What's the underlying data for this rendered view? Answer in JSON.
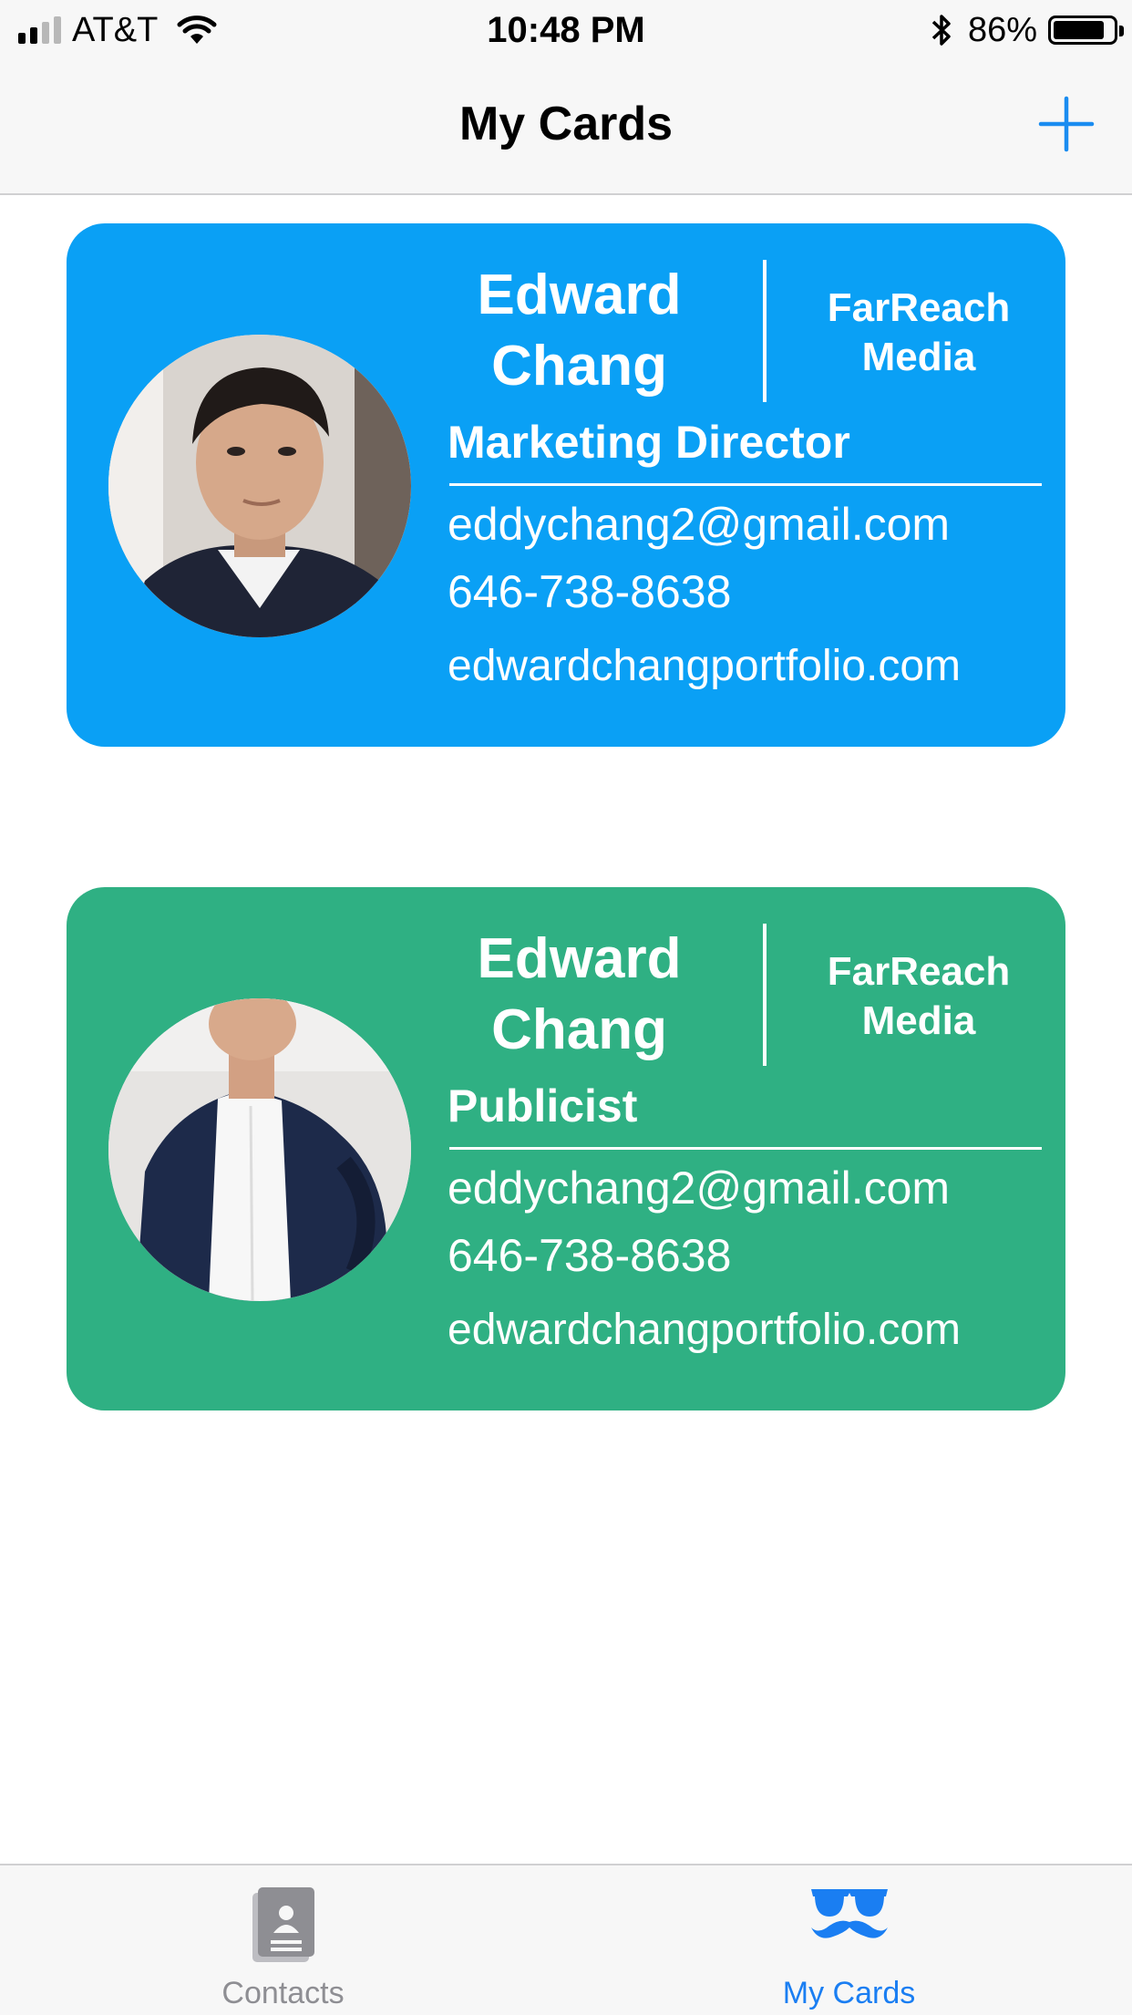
{
  "status_bar": {
    "carrier": "AT&T",
    "time": "10:48 PM",
    "battery_percent": "86%",
    "battery_level": 0.86,
    "signal_bars": 4,
    "signal_active": 2
  },
  "nav": {
    "title": "My Cards",
    "add_icon": "plus-icon",
    "accent_color": "#1a8cf0"
  },
  "cards": [
    {
      "background": "#0aa0f5",
      "first_name": "Edward",
      "last_name": "Chang",
      "company_line1": "FarReach",
      "company_line2": "Media",
      "job_title": "Marketing Director",
      "email": "eddychang2@gmail.com",
      "phone": "646-738-8638",
      "website": "edwardchangportfolio.com"
    },
    {
      "background": "#2fb083",
      "first_name": "Edward",
      "last_name": "Chang",
      "company_line1": "FarReach",
      "company_line2": "Media",
      "job_title": "Publicist",
      "email": "eddychang2@gmail.com",
      "phone": "646-738-8638",
      "website": "edwardchangportfolio.com"
    }
  ],
  "tab_bar": {
    "tabs": [
      {
        "label": "Contacts",
        "icon": "contacts-book-icon",
        "color": "#8e8e93",
        "selected": false
      },
      {
        "label": "My Cards",
        "icon": "sunglasses-mustache-icon",
        "color": "#1a7ef2",
        "selected": true
      }
    ]
  }
}
